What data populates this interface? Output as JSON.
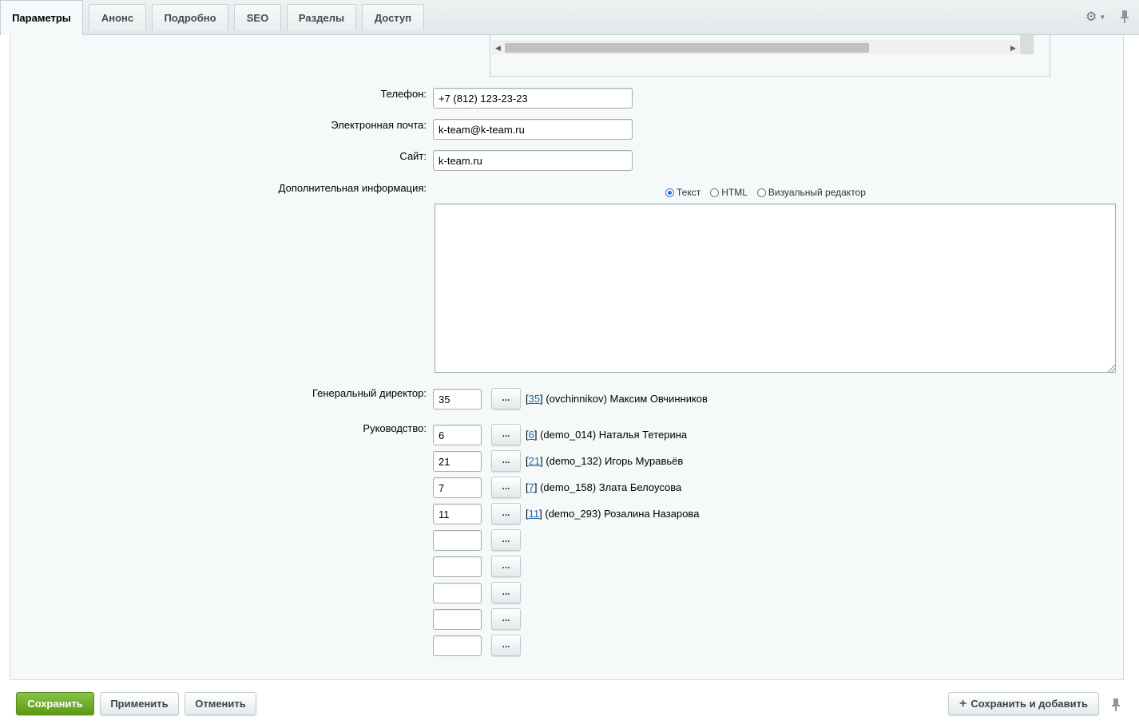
{
  "tabs": [
    {
      "label": "Параметры",
      "active": true
    },
    {
      "label": "Анонс"
    },
    {
      "label": "Подробно"
    },
    {
      "label": "SEO"
    },
    {
      "label": "Разделы"
    },
    {
      "label": "Доступ"
    }
  ],
  "form": {
    "phone": {
      "label": "Телефон:",
      "value": "+7 (812) 123-23-23"
    },
    "email": {
      "label": "Электронная почта:",
      "value": "k-team@k-team.ru"
    },
    "site": {
      "label": "Сайт:",
      "value": "k-team.ru"
    },
    "extra_info": {
      "label": "Дополнительная информация:",
      "modes": [
        "Текст",
        "HTML",
        "Визуальный редактор"
      ],
      "selected_mode": "Текст",
      "value": ""
    },
    "director": {
      "label": "Генеральный директор:",
      "value": "35",
      "id_link": "35",
      "name": "(ovchinnikov) Максим Овчинников"
    },
    "management": {
      "label": "Руководство:",
      "rows": [
        {
          "value": "6",
          "id_link": "6",
          "name": "(demo_014) Наталья Тетерина"
        },
        {
          "value": "21",
          "id_link": "21",
          "name": "(demo_132) Игорь Муравьёв"
        },
        {
          "value": "7",
          "id_link": "7",
          "name": "(demo_158) Злата Белоусова"
        },
        {
          "value": "11",
          "id_link": "11",
          "name": "(demo_293) Розалина Назарова"
        },
        {
          "value": ""
        },
        {
          "value": ""
        },
        {
          "value": ""
        },
        {
          "value": ""
        },
        {
          "value": ""
        }
      ]
    },
    "browse_button_label": "..."
  },
  "footer": {
    "save": "Сохранить",
    "apply": "Применить",
    "cancel": "Отменить",
    "save_and_add": "Сохранить и добавить"
  },
  "colors": {
    "save_button": "#6aac1f",
    "link": "#2067b0",
    "panel_bg": "#f5f9f9"
  },
  "icons": {
    "settings": "gear-icon",
    "pin": "pin-icon",
    "add": "plus-icon"
  }
}
